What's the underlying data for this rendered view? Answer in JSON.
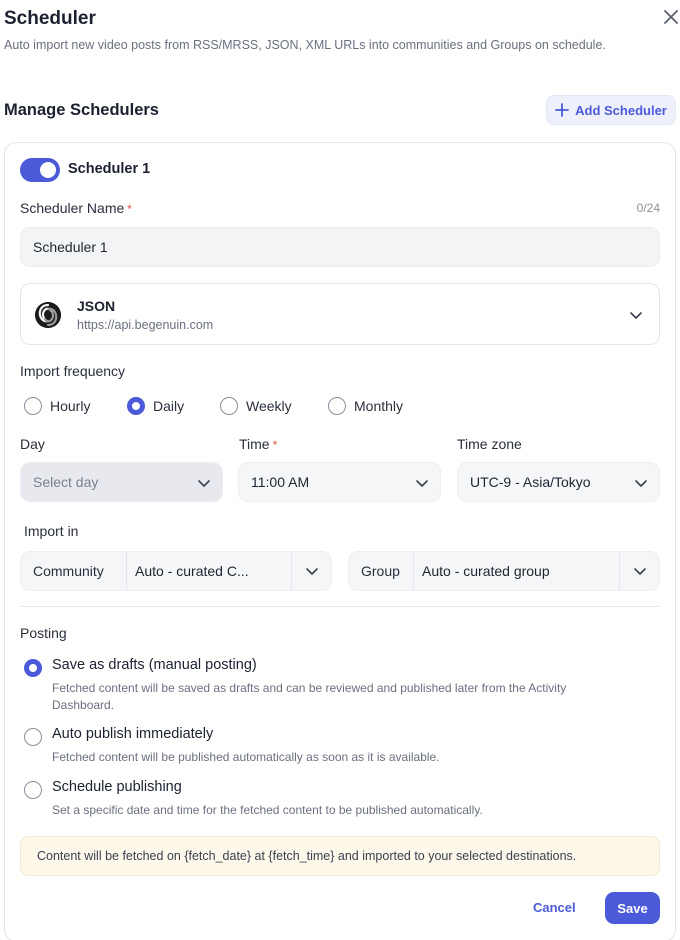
{
  "header": {
    "title": "Scheduler",
    "subtitle": "Auto import new video posts from RSS/MRSS, JSON, XML URLs into communities and Groups on schedule."
  },
  "manage": {
    "title": "Manage Schedulers",
    "add_label": "Add Scheduler"
  },
  "scheduler": {
    "enabled": true,
    "title": "Scheduler 1",
    "name_label": "Scheduler Name",
    "required_mark": "*",
    "name_value": "Scheduler 1",
    "name_counter": "0/24",
    "source": {
      "name": "JSON",
      "url": "https://api.begenuin.com"
    },
    "frequency": {
      "label": "Import frequency",
      "options": [
        "Hourly",
        "Daily",
        "Weekly",
        "Monthly"
      ],
      "selected": "Daily"
    },
    "day": {
      "label": "Day",
      "placeholder": "Select day"
    },
    "time": {
      "label": "Time",
      "value": "11:00 AM"
    },
    "timezone": {
      "label": "Time zone",
      "value": "UTC-9 - Asia/Tokyo"
    },
    "import_in": {
      "label": "Import in",
      "community_label": "Community",
      "community_value": "Auto - curated C...",
      "group_label": "Group",
      "group_value": "Auto - curated group"
    },
    "posting": {
      "label": "Posting",
      "selected": 0,
      "options": [
        {
          "title": "Save as drafts (manual posting)",
          "desc": "Fetched content will be saved as drafts and can be reviewed and published later from the Activity Dashboard."
        },
        {
          "title": "Auto publish immediately",
          "desc": "Fetched content will be published automatically as soon as it is available."
        },
        {
          "title": "Schedule publishing",
          "desc": "Set a specific date and time for the fetched content to be published automatically."
        }
      ]
    },
    "notice": "Content will be fetched on {fetch_date} at {fetch_time} and imported to your selected destinations."
  },
  "footer": {
    "cancel_label": "Cancel",
    "save_label": "Save"
  },
  "colors": {
    "accent": "#4a5ad8",
    "required": "#e0533d",
    "notice_bg": "#fdf8ea"
  }
}
